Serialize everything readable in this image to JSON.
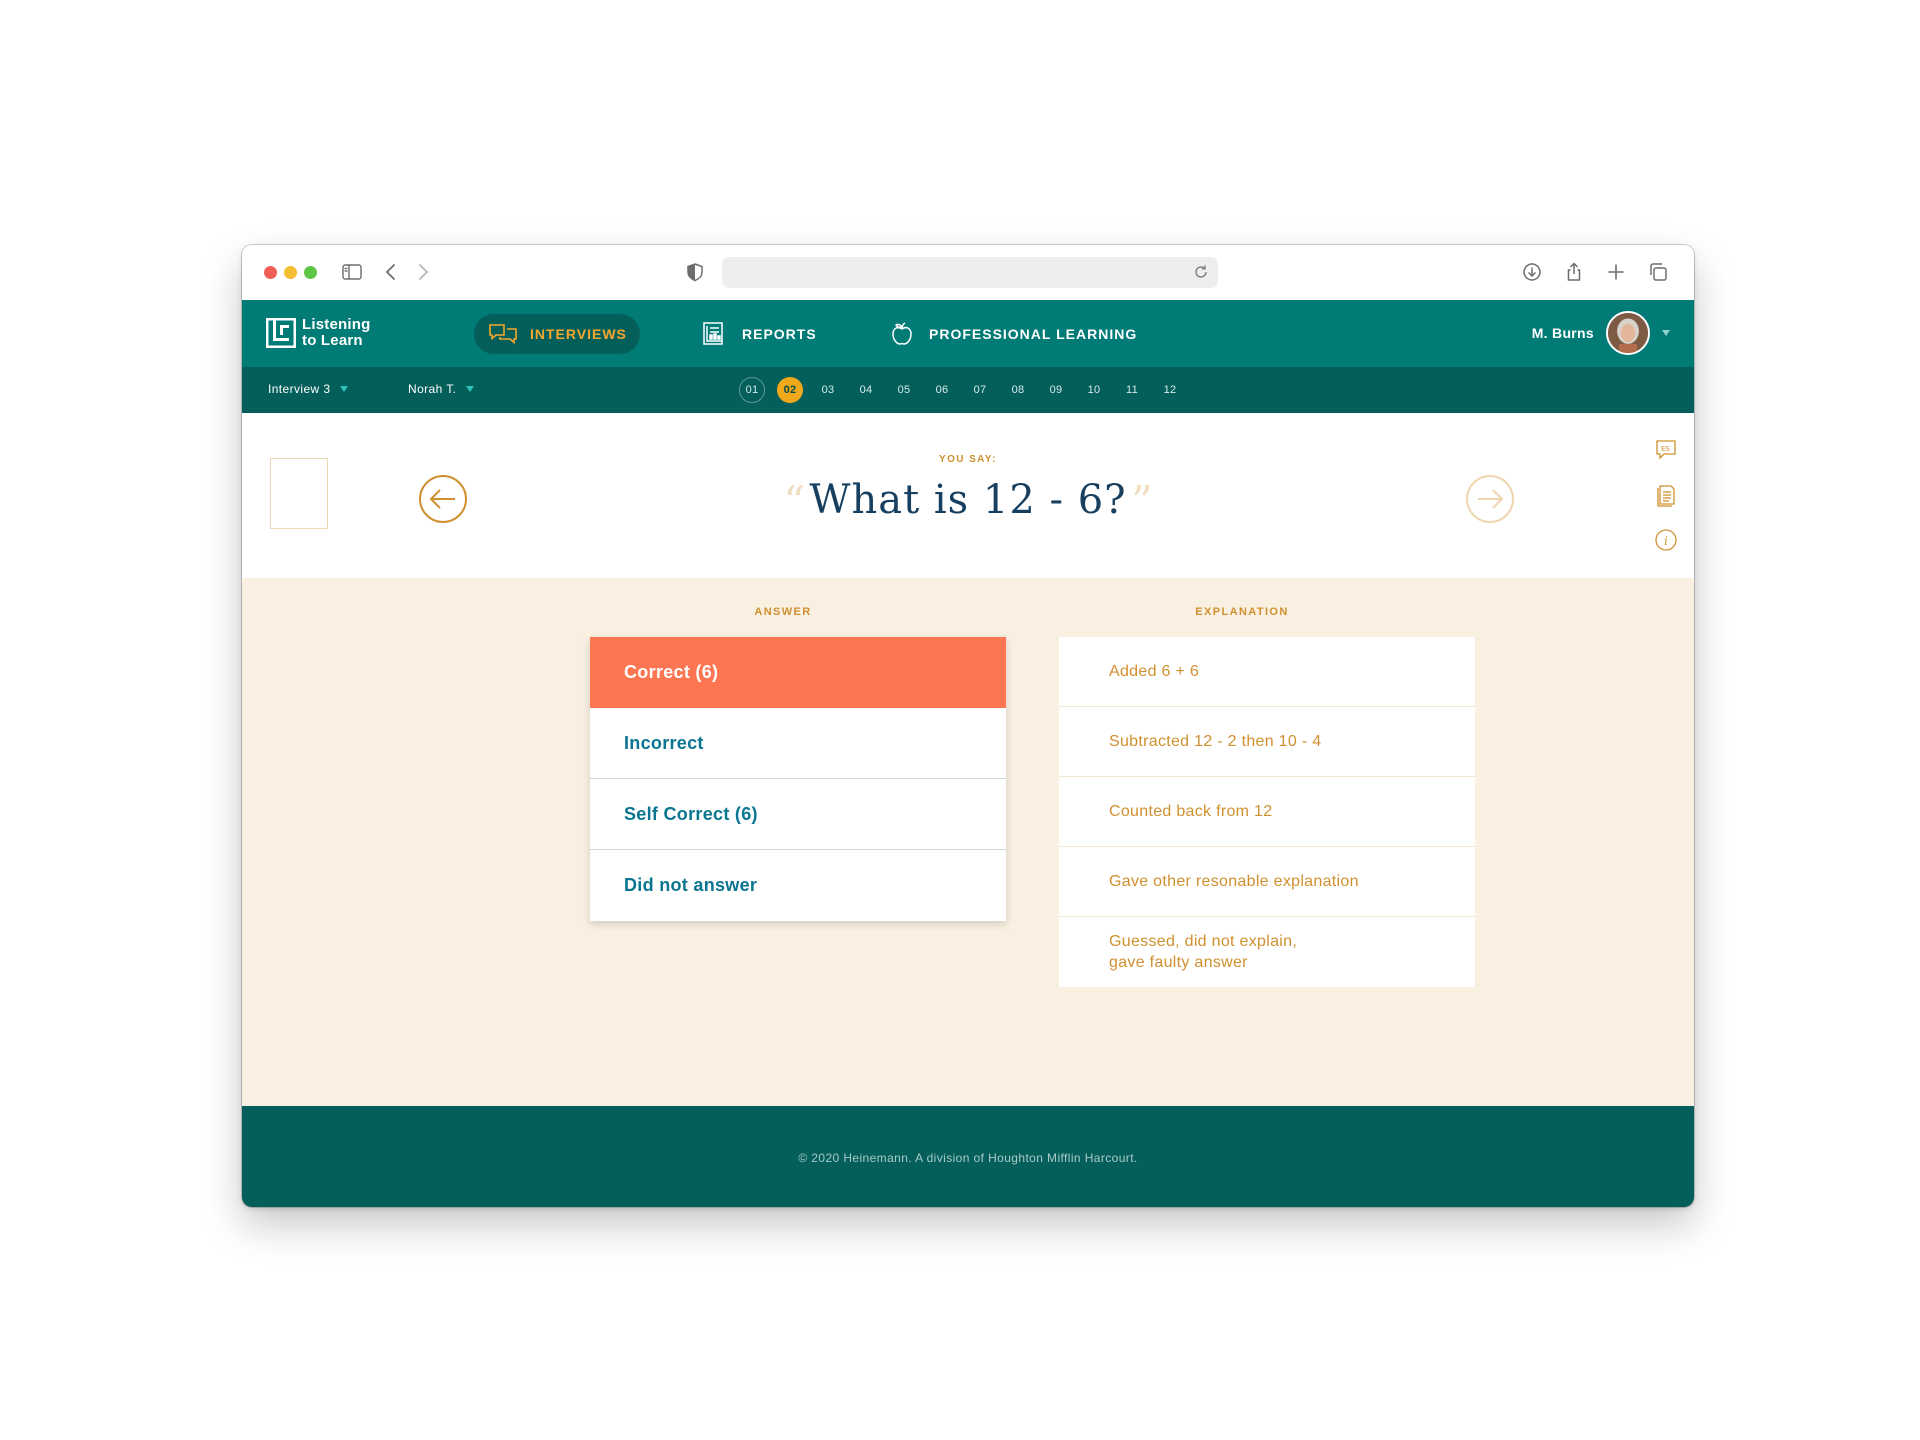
{
  "colors": {
    "teal": "#007b76",
    "teal_dark": "#045f5b",
    "accent_orange": "#fe7552",
    "gold": "#d0902f",
    "navy": "#173f5f",
    "cream": "#f9f0e1"
  },
  "browser": {
    "icons": [
      "sidebar-icon",
      "back-icon",
      "forward-icon",
      "shield-icon",
      "reload-icon",
      "download-icon",
      "share-icon",
      "new-tab-icon",
      "tabs-icon"
    ]
  },
  "brand": {
    "line1": "Listening",
    "line2": "to Learn"
  },
  "nav": {
    "interviews": "INTERVIEWS",
    "reports": "REPORTS",
    "professional_learning": "PROFESSIONAL LEARNING"
  },
  "user": {
    "name": "M. Burns"
  },
  "subnav": {
    "interview": "Interview 3",
    "student": "Norah T.",
    "pages": [
      "01",
      "02",
      "03",
      "04",
      "05",
      "06",
      "07",
      "08",
      "09",
      "10",
      "11",
      "12"
    ],
    "current_page": "02",
    "visited_page": "01"
  },
  "question": {
    "label": "YOU SAY:",
    "open_quote": "“",
    "text": "What is 12 - 6?",
    "close_quote": "”"
  },
  "answer_section": {
    "title": "ANSWER",
    "options": [
      "Correct (6)",
      "Incorrect",
      "Self Correct (6)",
      "Did not answer"
    ],
    "selected": "Correct (6)"
  },
  "explanation_section": {
    "title": "EXPLANATION",
    "options": [
      "Added 6 + 6",
      "Subtracted 12 - 2 then 10 - 4",
      "Counted back from 12",
      "Gave other resonable explanation",
      "Guessed, did not explain,\ngave faulty answer"
    ]
  },
  "footer": {
    "copyright": "© 2020 Heinemann.  A division of Houghton Mifflin Harcourt."
  }
}
